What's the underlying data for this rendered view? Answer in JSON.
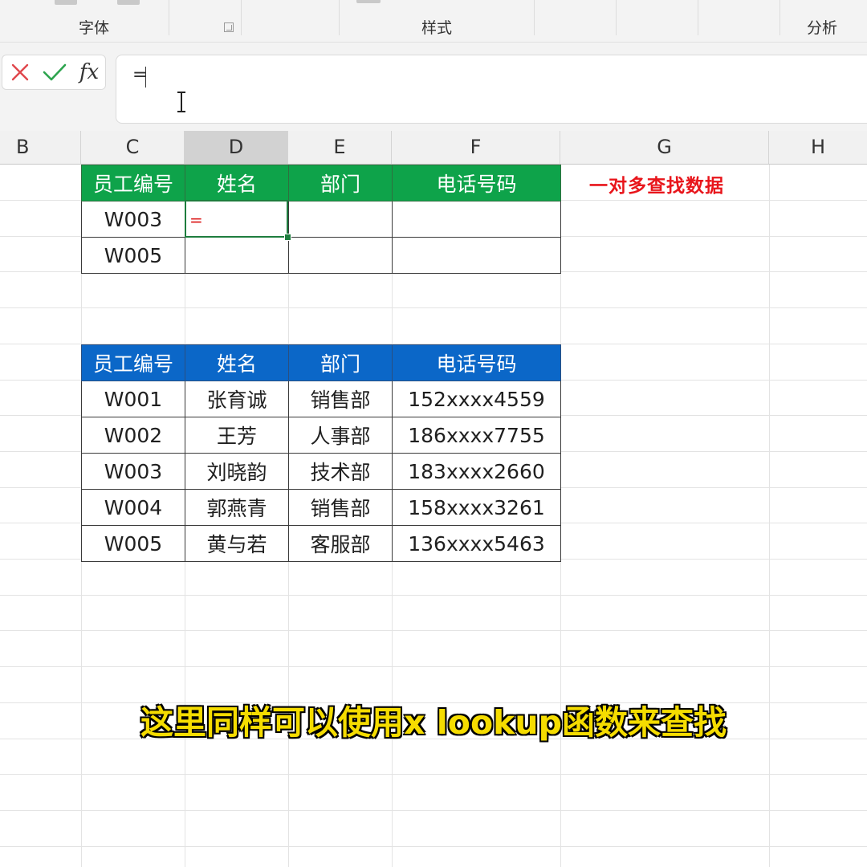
{
  "ribbon": {
    "groups": [
      {
        "label": "字体"
      },
      {
        "label": "样式"
      },
      {
        "label": "分析"
      }
    ]
  },
  "formula_bar": {
    "value": "="
  },
  "icons": {
    "cancel": "close-icon",
    "confirm": "check-icon",
    "insert_function": "fx-icon",
    "cursor": "i-beam-cursor-icon"
  },
  "fx_label": "fx",
  "colors": {
    "lookup_header": "#0ea34a",
    "source_header": "#0b67c8",
    "note": "#e8151b",
    "subtitle": "#f5dc00",
    "active_cell": "#1e7d3e",
    "cancel": "#e0474c",
    "confirm": "#2da44e"
  },
  "columns": [
    "B",
    "C",
    "D",
    "E",
    "F",
    "G",
    "H"
  ],
  "selected_column": "D",
  "lookup_table": {
    "headers": [
      "员工编号",
      "姓名",
      "部门",
      "电话号码"
    ],
    "rows": [
      [
        "W003",
        "",
        "",
        ""
      ],
      [
        "W005",
        "",
        "",
        ""
      ]
    ],
    "active_cell_value": "="
  },
  "source_table": {
    "headers": [
      "员工编号",
      "姓名",
      "部门",
      "电话号码"
    ],
    "rows": [
      [
        "W001",
        "张育诚",
        "销售部",
        "152xxxx4559"
      ],
      [
        "W002",
        "王芳",
        "人事部",
        "186xxxx7755"
      ],
      [
        "W003",
        "刘晓韵",
        "技术部",
        "183xxxx2660"
      ],
      [
        "W004",
        "郭燕青",
        "销售部",
        "158xxxx3261"
      ],
      [
        "W005",
        "黄与若",
        "客服部",
        "136xxxx5463"
      ]
    ]
  },
  "note": "一对多查找数据",
  "subtitle": "这里同样可以使用x lookup函数来查找"
}
